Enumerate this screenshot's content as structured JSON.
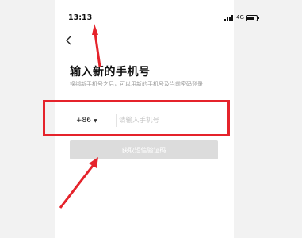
{
  "status": {
    "time": "13:13",
    "network": "4G"
  },
  "page": {
    "title": "输入新的手机号",
    "subtitle": "换绑新手机号之后，可以用新的手机号及当前密码登录"
  },
  "phone_field": {
    "country_code": "+86",
    "placeholder": "请输入手机号"
  },
  "actions": {
    "get_code_label": "获取短信验证码"
  },
  "colors": {
    "annotation": "#e5232b",
    "disabled_button": "#dcdcdc"
  },
  "icons": [
    "back-arrow-icon",
    "signal-icon",
    "battery-icon",
    "chevron-down-icon"
  ]
}
